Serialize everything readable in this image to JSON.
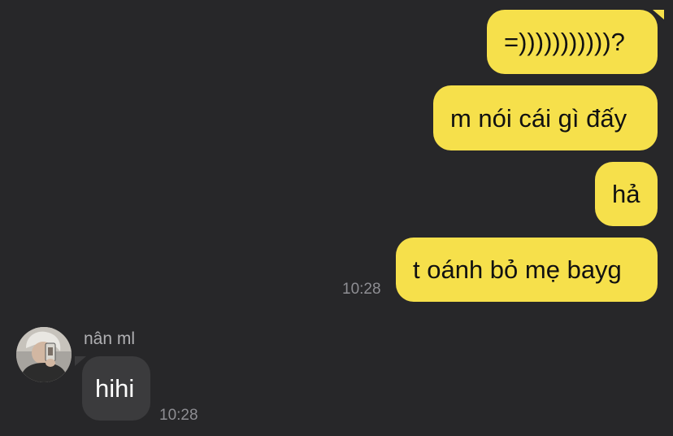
{
  "messages": {
    "outgoing": [
      {
        "text": "=)))))))))))?"
      },
      {
        "text": "m nói cái gì đấy"
      },
      {
        "text": "hả"
      },
      {
        "text": "t oánh bỏ mẹ bayg",
        "time": "10:28"
      }
    ],
    "incoming": {
      "sender": "nân ml",
      "avatar_icon": "user-avatar-photo",
      "messages": [
        {
          "text": "hihi",
          "time": "10:28"
        }
      ]
    }
  },
  "colors": {
    "background": "#272729",
    "outgoing_bubble": "#f6e04b",
    "incoming_bubble": "#3b3b3d",
    "timestamp": "#8e8e93"
  }
}
